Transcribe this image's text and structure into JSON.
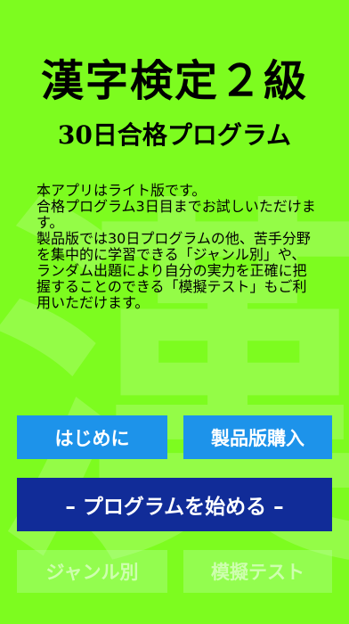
{
  "app": {
    "title": "漢字検定２級",
    "subtitle": "30日合格プログラム",
    "watermark_char": "漢",
    "description": "本アプリはライト版です。\n合格プログラム3日目までお試しいただけます。\n製品版では30日プログラムの他、苦手分野を集中的に学習できる「ジャンル別」や、ランダム出題により自分の実力を正確に把握することのできる「模擬テスト」もご利用いただけます。"
  },
  "buttons": {
    "intro": "はじめに",
    "buy": "製品版購入",
    "program": "– プログラムを始める –",
    "genre": "ジャンル別",
    "mock_test": "模擬テスト"
  },
  "colors": {
    "background": "#7dfc1f",
    "blue_button": "#1d93ea",
    "navy_button": "#112c98",
    "text": "#000000",
    "button_text": "#ffffff"
  }
}
